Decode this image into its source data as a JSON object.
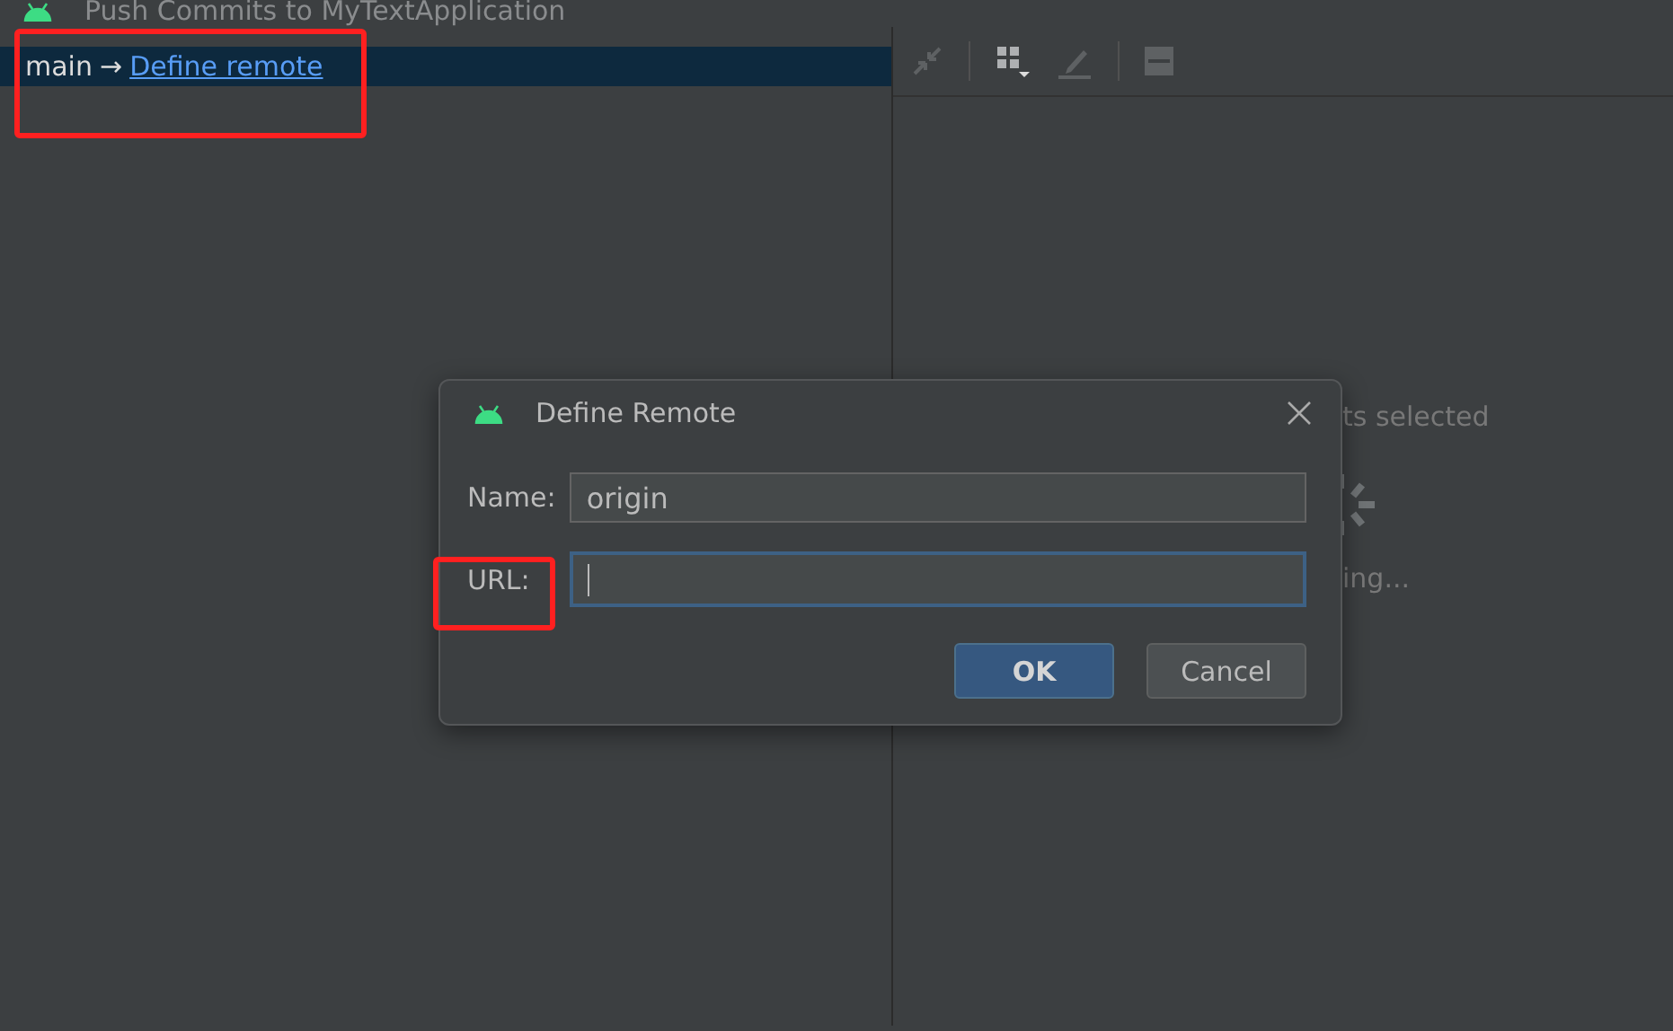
{
  "window": {
    "title": "Push Commits to MyTextApplication"
  },
  "branch_row": {
    "branch": "main",
    "arrow": "→",
    "link": "Define remote",
    "selected": true
  },
  "toolbar": {
    "items": [
      {
        "kind": "icon"
      },
      {
        "kind": "separator"
      },
      {
        "kind": "icon"
      },
      {
        "kind": "icon"
      },
      {
        "kind": "separator"
      },
      {
        "kind": "icon"
      }
    ]
  },
  "details": {
    "status_fragment": "ts selected",
    "loading_fragment": "ing..."
  },
  "dialog": {
    "title": "Define Remote",
    "fields": [
      {
        "label": "Name:",
        "value": "origin",
        "focused": false
      },
      {
        "label": "URL:",
        "focused": true
      }
    ],
    "buttons": [
      {
        "label": "OK",
        "default": true
      },
      {
        "label": "Cancel",
        "default": false
      }
    ]
  },
  "annotations": [
    {
      "kind": "box"
    },
    {
      "kind": "box"
    }
  ]
}
